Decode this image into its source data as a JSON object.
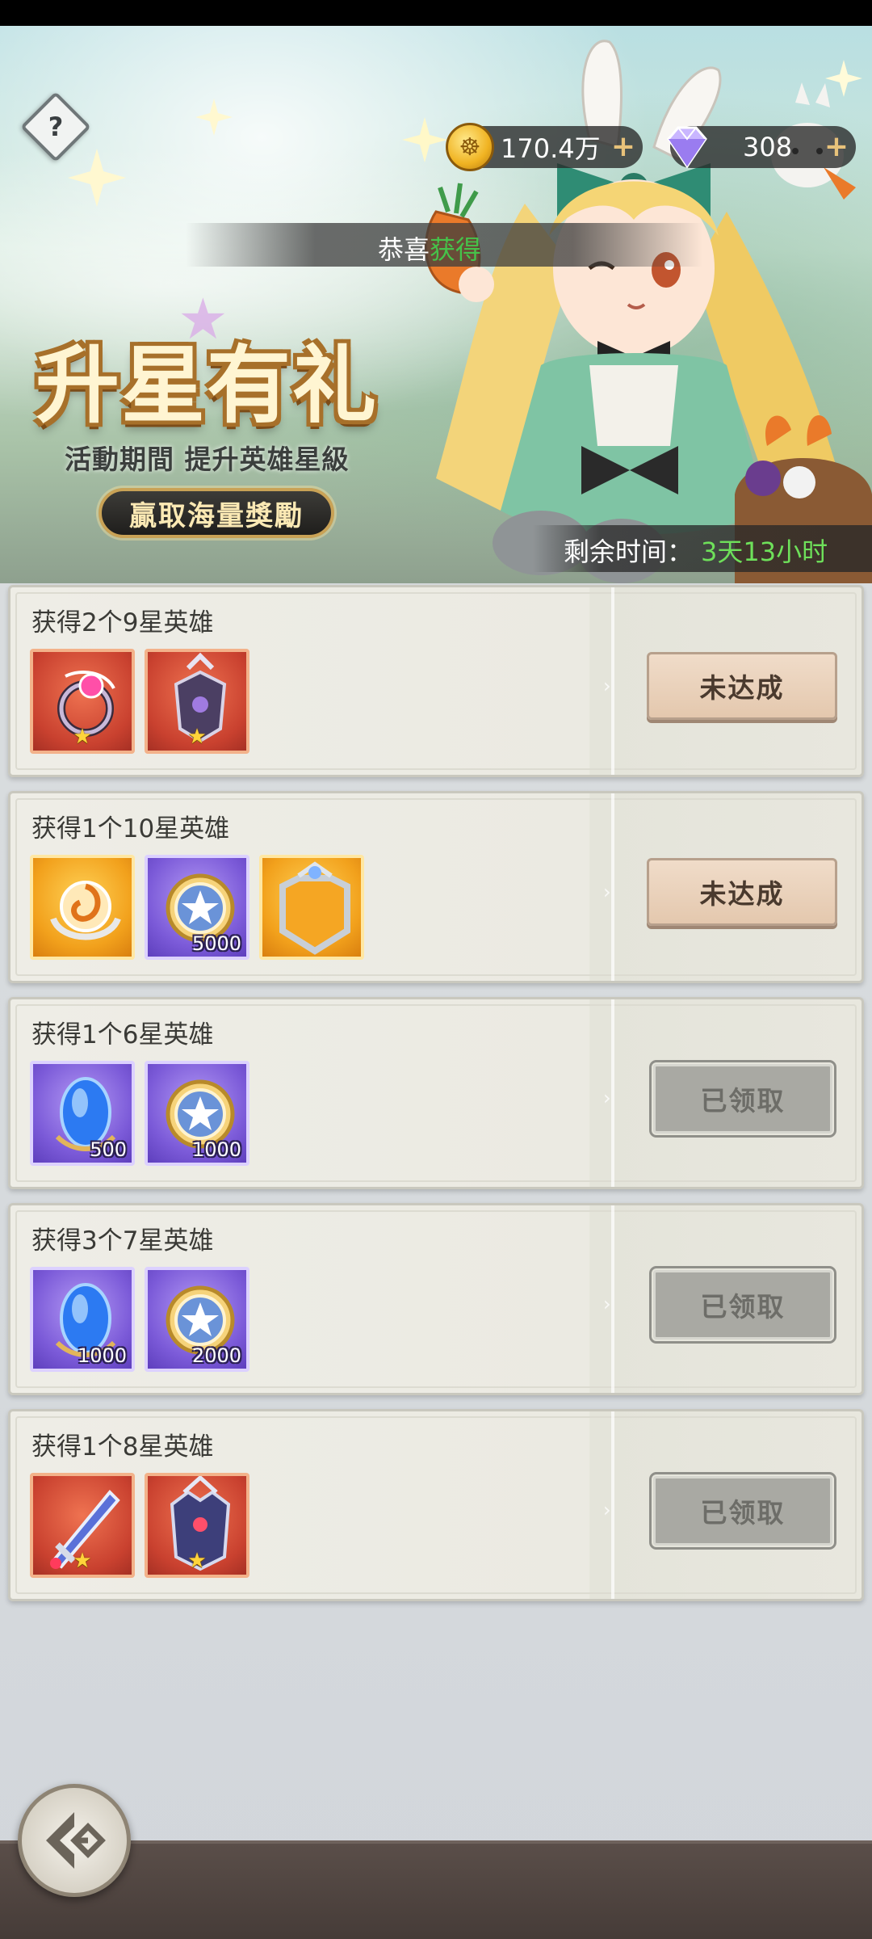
{
  "header": {
    "help_label": "?",
    "gold_amount": "170.4万",
    "gem_amount": "308",
    "plus_label": "+",
    "congrats_prefix": "恭喜",
    "congrats_highlight": "获得"
  },
  "banner": {
    "title": "升星有礼",
    "subtitle": "活動期間  提升英雄星級",
    "tagline": "贏取海量獎勵",
    "time_label": "剩余时间：",
    "time_value": "3天13小时"
  },
  "tasks": [
    {
      "title": "获得2个9星英雄",
      "button": "未达成",
      "status": "unreached",
      "items": [
        {
          "icon": "ring-icon",
          "rarity": "red",
          "star": "★",
          "count": ""
        },
        {
          "icon": "armor-icon",
          "rarity": "red",
          "star": "★",
          "count": ""
        }
      ]
    },
    {
      "title": "获得1个10星英雄",
      "button": "未达成",
      "status": "unreached",
      "items": [
        {
          "icon": "swirl-emblem-icon",
          "rarity": "orange",
          "star": "",
          "count": ""
        },
        {
          "icon": "star-coin-icon",
          "rarity": "purple",
          "star": "",
          "count": "5000"
        },
        {
          "icon": "frame-crest-icon",
          "rarity": "orange",
          "star": "",
          "count": ""
        }
      ]
    },
    {
      "title": "获得1个6星英雄",
      "button": "已领取",
      "status": "claimed",
      "items": [
        {
          "icon": "blue-crystal-icon",
          "rarity": "purple",
          "star": "",
          "count": "500"
        },
        {
          "icon": "star-coin-icon",
          "rarity": "purple",
          "star": "",
          "count": "1000"
        }
      ]
    },
    {
      "title": "获得3个7星英雄",
      "button": "已领取",
      "status": "claimed",
      "items": [
        {
          "icon": "blue-crystal-icon",
          "rarity": "purple",
          "star": "",
          "count": "1000"
        },
        {
          "icon": "star-coin-icon",
          "rarity": "purple",
          "star": "",
          "count": "2000"
        }
      ]
    },
    {
      "title": "获得1个8星英雄",
      "button": "已领取",
      "status": "claimed",
      "items": [
        {
          "icon": "sword-icon",
          "rarity": "red",
          "star": "★",
          "count": ""
        },
        {
          "icon": "chest-armor-icon",
          "rarity": "red",
          "star": "★",
          "count": ""
        }
      ]
    }
  ],
  "colors": {
    "time_value": "#6ee05a",
    "congrats_highlight": "#46c24a",
    "unreached_button": "#e8cfb7",
    "claimed_button": "#a9a9a3",
    "rarity_red": "#d14a33",
    "rarity_orange": "#f2a11c",
    "rarity_purple": "#7b5ad8"
  }
}
